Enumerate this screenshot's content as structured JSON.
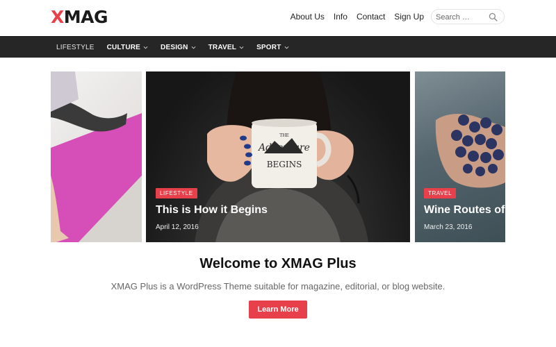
{
  "colors": {
    "accent": "#e8404a",
    "navbar_bg": "#262626",
    "text_dark": "#111111"
  },
  "header": {
    "logo_first": "X",
    "logo_rest": "MAG",
    "links": [
      "About Us",
      "Info",
      "Contact",
      "Sign Up"
    ],
    "search": {
      "placeholder": "Search …",
      "icon": "search-icon"
    }
  },
  "nav": {
    "items": [
      {
        "label": "LIFESTYLE",
        "dropdown": false
      },
      {
        "label": "CULTURE",
        "dropdown": true
      },
      {
        "label": "DESIGN",
        "dropdown": true
      },
      {
        "label": "TRAVEL",
        "dropdown": true
      },
      {
        "label": "SPORT",
        "dropdown": true
      }
    ]
  },
  "slider": {
    "slides": [
      {
        "category": "",
        "title": "",
        "date": ""
      },
      {
        "category": "LIFESTYLE",
        "title": "This is How it Begins",
        "date": "April 12, 2016",
        "mug_text": "THE Adventure BEGINS"
      },
      {
        "category": "TRAVEL",
        "title": "Wine Routes of I",
        "date": "March 23, 2016"
      }
    ]
  },
  "welcome": {
    "title": "Welcome to XMAG Plus",
    "description": "XMAG Plus is a WordPress Theme suitable for magazine, editorial, or blog website.",
    "button_label": "Learn More"
  }
}
